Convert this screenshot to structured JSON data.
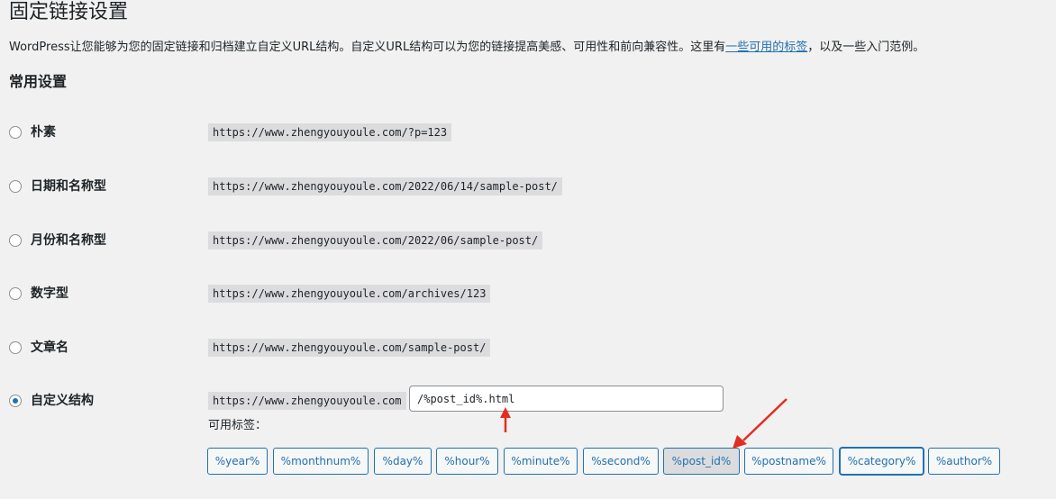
{
  "page": {
    "title": "固定链接设置",
    "intro_before": "WordPress让您能够为您的固定链接和归档建立自定义URL结构。自定义URL结构可以为您的链接提高美感、可用性和前向兼容性。这里有",
    "intro_link": "一些可用的标签",
    "intro_after": "，以及一些入门范例。"
  },
  "common_settings": {
    "title": "常用设置",
    "options": [
      {
        "label": "朴素",
        "url": "https://www.zhengyouyoule.com/?p=123",
        "checked": false
      },
      {
        "label": "日期和名称型",
        "url": "https://www.zhengyouyoule.com/2022/06/14/sample-post/",
        "checked": false
      },
      {
        "label": "月份和名称型",
        "url": "https://www.zhengyouyoule.com/2022/06/sample-post/",
        "checked": false
      },
      {
        "label": "数字型",
        "url": "https://www.zhengyouyoule.com/archives/123",
        "checked": false
      },
      {
        "label": "文章名",
        "url": "https://www.zhengyouyoule.com/sample-post/",
        "checked": false
      },
      {
        "label": "自定义结构",
        "url": "https://www.zhengyouyoule.com",
        "checked": true
      }
    ],
    "custom_structure_value": "/%post_id%.html",
    "available_tags_label": "可用标签：",
    "tags": [
      "%year%",
      "%monthnum%",
      "%day%",
      "%hour%",
      "%minute%",
      "%second%",
      "%post_id%",
      "%postname%",
      "%category%",
      "%author%"
    ],
    "active_tag": "%post_id%",
    "focused_tag": "%category%"
  },
  "colors": {
    "accent": "#2271b1",
    "annotation_arrow": "#e32d20"
  }
}
